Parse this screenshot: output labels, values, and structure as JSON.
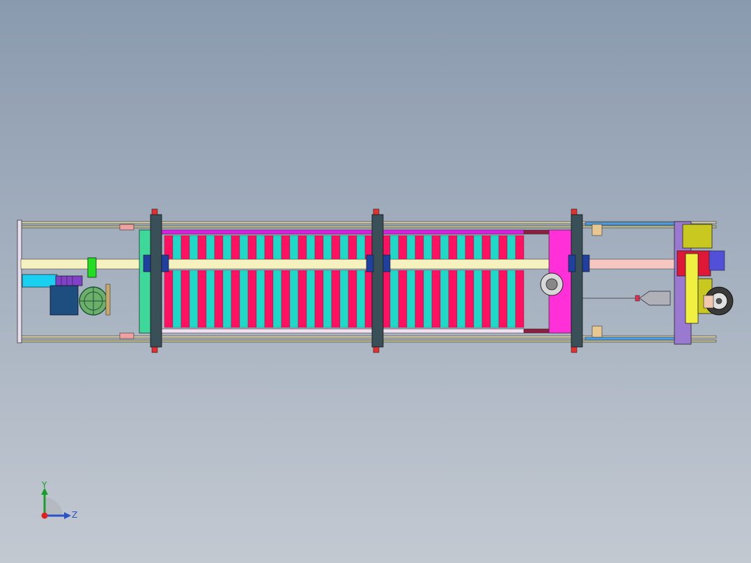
{
  "viewport": {
    "background_top": "#8a9aae",
    "background_bottom": "#c3c9d1"
  },
  "triad": {
    "y_label": "Y",
    "z_label": "Z",
    "y_color": "#1a9e2a",
    "z_color": "#2a52c8",
    "origin_color": "#e02020"
  },
  "model": {
    "icon": "cad-assembly-model"
  }
}
